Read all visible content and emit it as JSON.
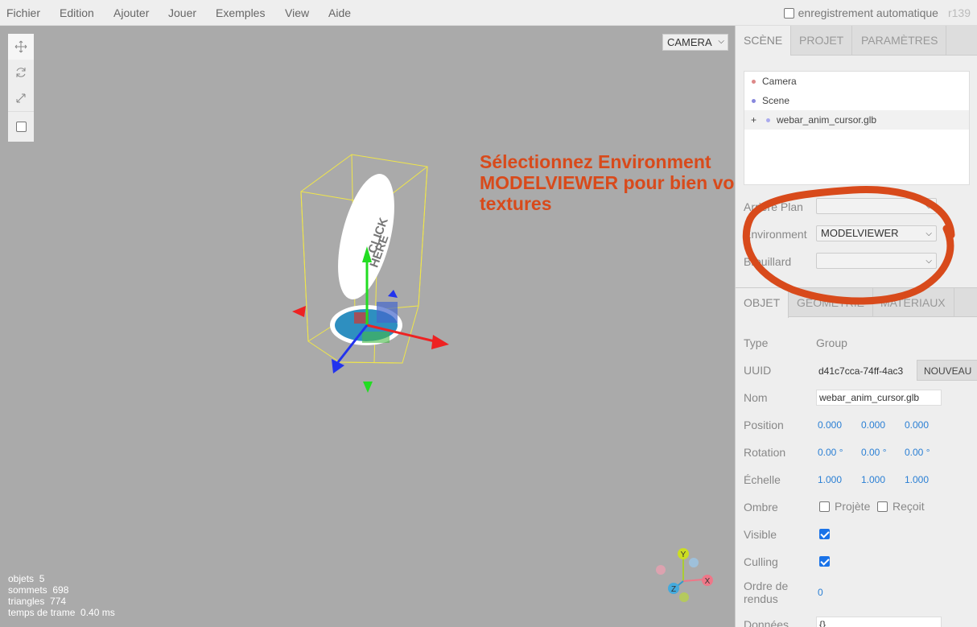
{
  "menubar": {
    "items": [
      "Fichier",
      "Edition",
      "Ajouter",
      "Jouer",
      "Exemples",
      "View",
      "Aide"
    ],
    "autosave_label": "enregistrement automatique",
    "version": "r139"
  },
  "toolbar": {
    "icons": [
      "move-icon",
      "rotate-icon",
      "scale-icon"
    ],
    "local_checkbox": false
  },
  "viewport": {
    "camera_select": "CAMERA",
    "model_text_1": "CLICK",
    "model_text_2": "HERE",
    "annotation": "Sélectionnez Environment MODELVIEWER pour bien voir les textures",
    "info": {
      "objects_label": "objets",
      "objects_value": "5",
      "vertices_label": "sommets",
      "vertices_value": "698",
      "triangles_label": "triangles",
      "triangles_value": "774",
      "frametime_label": "temps de trame",
      "frametime_value": "0.40 ms"
    },
    "view_helper": {
      "y": "Y",
      "x": "X",
      "z": "Z"
    }
  },
  "sidebar": {
    "top_tabs": [
      "SCÈNE",
      "PROJET",
      "PARAMÈTRES"
    ],
    "outliner": {
      "items": [
        {
          "label": "Camera",
          "color": "#dd8888"
        },
        {
          "label": "Scene",
          "color": "#8888dd"
        },
        {
          "label": "webar_anim_cursor.glb",
          "color": "#aaaaee",
          "expander": "+"
        }
      ]
    },
    "scene_props": {
      "background_label": "Arrière Plan",
      "background_value": "",
      "environment_label": "Environment",
      "environment_value": "MODELVIEWER",
      "fog_label": "Brouillard",
      "fog_value": ""
    },
    "object_tabs": [
      "OBJET",
      "GÉOMÉTRIE",
      "MATÉRIAUX"
    ],
    "object": {
      "type_label": "Type",
      "type_value": "Group",
      "uuid_label": "UUID",
      "uuid_value": "d41c7cca-74ff-4ac3",
      "uuid_button": "NOUVEAU",
      "name_label": "Nom",
      "name_value": "webar_anim_cursor.glb",
      "position_label": "Position",
      "position": [
        "0.000",
        "0.000",
        "0.000"
      ],
      "rotation_label": "Rotation",
      "rotation": [
        "0.00 °",
        "0.00 °",
        "0.00 °"
      ],
      "scale_label": "Échelle",
      "scale": [
        "1.000",
        "1.000",
        "1.000"
      ],
      "shadow_label": "Ombre",
      "cast_label": "Projète",
      "receive_label": "Reçoit",
      "cast": false,
      "receive": false,
      "visible_label": "Visible",
      "visible": true,
      "culling_label": "Culling",
      "culling": true,
      "render_order_label_1": "Ordre de",
      "render_order_label_2": "rendus",
      "render_order_value": "0",
      "data_label": "Données",
      "data_value": "{}"
    }
  },
  "colors": {
    "annotation": "#d84a1b",
    "accent": "#2a7fd4",
    "viewport_bg": "#aaaaaa"
  }
}
